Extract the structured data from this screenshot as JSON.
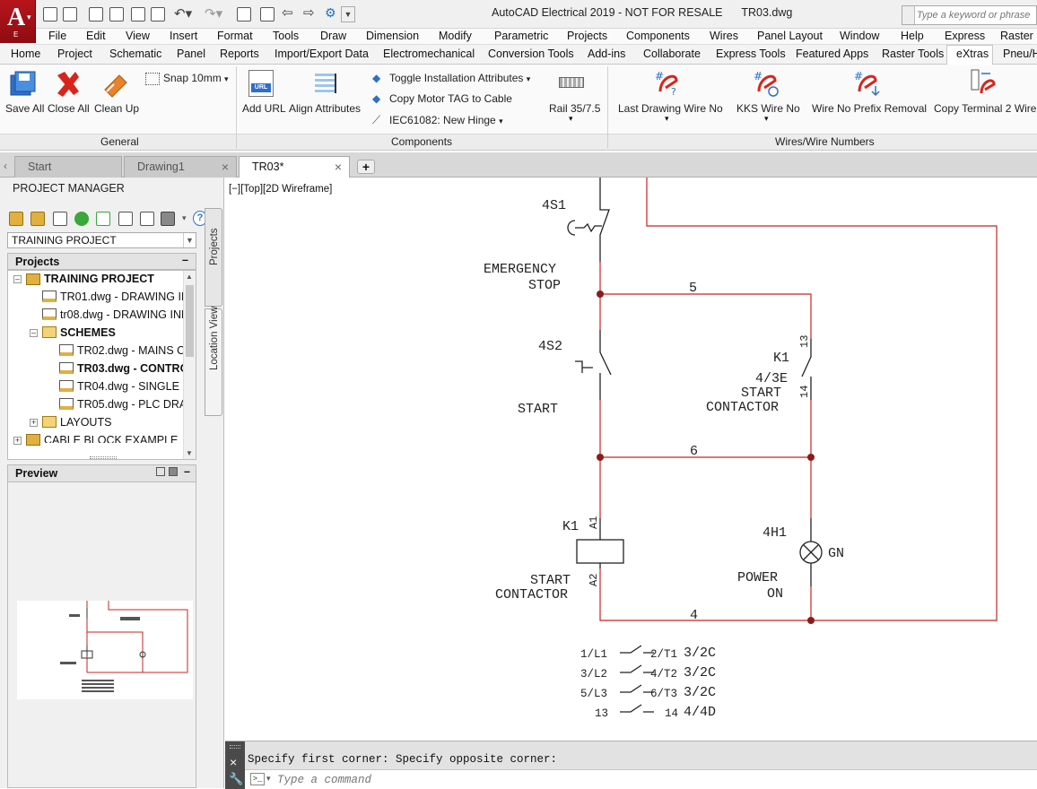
{
  "title": {
    "app": "AutoCAD Electrical 2019 - NOT FOR RESALE",
    "file": "TR03.dwg",
    "app_letter": "A",
    "app_sub": "E"
  },
  "search": {
    "placeholder": "Type a keyword or phrase"
  },
  "menubar": [
    "File",
    "Edit",
    "View",
    "Insert",
    "Format",
    "Tools",
    "Draw",
    "Dimension",
    "Modify",
    "Parametric",
    "Projects",
    "Components",
    "Wires",
    "Panel Layout",
    "Window",
    "Help",
    "Express",
    "Raster"
  ],
  "ribbon_tabs": [
    "Home",
    "Project",
    "Schematic",
    "Panel",
    "Reports",
    "Import/Export Data",
    "Electromechanical",
    "Conversion Tools",
    "Add-ins",
    "Collaborate",
    "Express Tools",
    "Featured Apps",
    "Raster Tools",
    "eXtras",
    "Pneu/H"
  ],
  "ribbon": {
    "general": {
      "title": "General",
      "save_all": "Save All",
      "close_all": "Close All",
      "clean_up": "Clean Up",
      "snap": "Snap 10mm"
    },
    "components": {
      "title": "Components",
      "add_url": "Add URL",
      "align_attributes": "Align Attributes",
      "toggle": "Toggle Installation Attributes",
      "copy_motor": "Copy Motor TAG to Cable",
      "iec": "IEC61082: New Hinge",
      "rail": "Rail 35/7.5",
      "url_badge": "URL"
    },
    "wires": {
      "title": "Wires/Wire Numbers",
      "last_drawing": "Last Drawing Wire No",
      "kks": "KKS Wire No",
      "prefix": "Wire No Prefix Removal",
      "copy_terminal": "Copy Terminal 2 Wire"
    }
  },
  "doc_tabs": [
    {
      "label": "Start"
    },
    {
      "label": "Drawing1"
    },
    {
      "label": "TR03*"
    }
  ],
  "project_manager": {
    "title": "PROJECT MANAGER",
    "selected_project": "TRAINING PROJECT",
    "projects_header": "Projects",
    "tree": {
      "root": "TRAINING PROJECT",
      "tr01": "TR01.dwg - DRAWING IN",
      "tr08": "tr08.dwg - DRAWING IND",
      "schemes": "SCHEMES",
      "tr02": "TR02.dwg - MAINS CI",
      "tr03": "TR03.dwg - CONTRO",
      "tr04": "TR04.dwg - SINGLE LI",
      "tr05": "TR05.dwg - PLC DRAV",
      "layouts": "LAYOUTS",
      "cable": "CABLE BLOCK EXAMPLE"
    },
    "preview_header": "Preview",
    "side_tabs": {
      "projects": "Projects",
      "location": "Location View"
    }
  },
  "canvas": {
    "view_control": "[−][Top][2D Wireframe]",
    "labels": {
      "s1": "4S1",
      "emergency": "EMERGENCY",
      "stop": "STOP",
      "wire5": "5",
      "s2": "4S2",
      "start_label": "START",
      "k1_top": "K1",
      "contact_ref": "4/3E",
      "start_word": "START",
      "contactor_word": "CONTACTOR",
      "n13": "13",
      "n14": "14",
      "wire6": "6",
      "k1_coil": "K1",
      "a1": "A1",
      "a2": "A2",
      "coil_start": "START",
      "coil_contactor": "CONTACTOR",
      "h1": "4H1",
      "gn": "GN",
      "power": "POWER",
      "on": "ON",
      "wire4": "4"
    },
    "contacts": [
      {
        "left": "1/L1",
        "right": "2/T1",
        "ref": "3/2C"
      },
      {
        "left": "3/L2",
        "right": "4/T2",
        "ref": "3/2C"
      },
      {
        "left": "5/L3",
        "right": "6/T3",
        "ref": "3/2C"
      },
      {
        "left": "13",
        "right": "14",
        "ref": "4/4D"
      }
    ],
    "colors": {
      "wire": "#cc2222",
      "symbol": "#222222",
      "background": "#ffffff"
    }
  },
  "command": {
    "history": "Specify first corner: Specify opposite corner:",
    "placeholder": "Type a command",
    "prompt_icon": ">_"
  }
}
